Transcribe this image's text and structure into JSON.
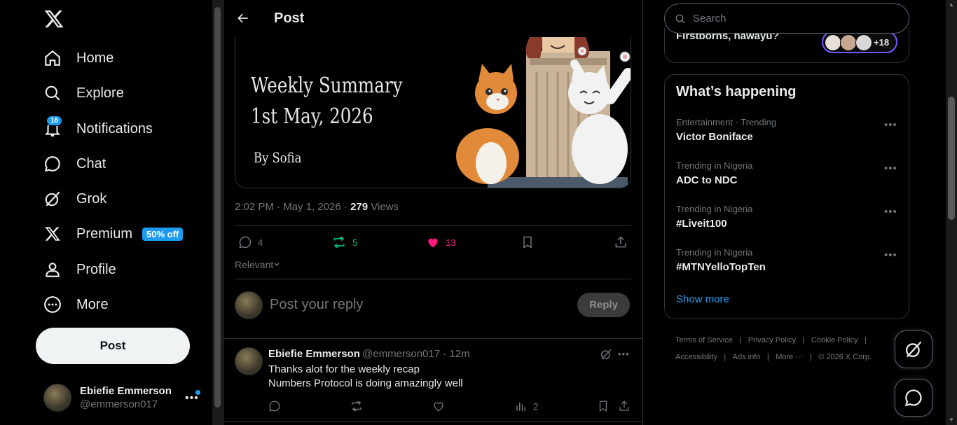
{
  "nav": {
    "items": [
      {
        "label": "Home",
        "icon": "home-icon"
      },
      {
        "label": "Explore",
        "icon": "search-icon"
      },
      {
        "label": "Notifications",
        "icon": "bell-icon",
        "badge": "18"
      },
      {
        "label": "Chat",
        "icon": "chat-icon"
      },
      {
        "label": "Grok",
        "icon": "grok-icon"
      },
      {
        "label": "Premium",
        "icon": "x-logo-icon",
        "promo": "50% off"
      },
      {
        "label": "Profile",
        "icon": "person-icon"
      },
      {
        "label": "More",
        "icon": "more-circle-icon"
      }
    ],
    "post_button": "Post"
  },
  "account": {
    "name": "Ebiefie Emmerson",
    "handle": "@emmerson017"
  },
  "header": {
    "title": "Post"
  },
  "media": {
    "line1": "Weekly Summary",
    "line2": "1st May, 2026",
    "line3": "By Sofia"
  },
  "post_meta": {
    "time": "2:02 PM · May 1, 2026 · ",
    "views_count": "279",
    "views_label": " Views"
  },
  "actions": {
    "replies": "4",
    "reposts": "5",
    "likes": "13"
  },
  "sort": {
    "label": "Relevant"
  },
  "reply_box": {
    "placeholder": "Post your reply",
    "button": "Reply"
  },
  "comment": {
    "name": "Ebiefie Emmerson",
    "handle": "@emmerson017 · 12m",
    "lines": [
      "Thanks alot for the weekly recap",
      "Numbers Protocol is doing amazingly well"
    ],
    "views": "2"
  },
  "search": {
    "placeholder": "Search"
  },
  "prev_card": {
    "text": "Firstborns, nawayu?",
    "count": "+18"
  },
  "trends": {
    "title": "What’s happening",
    "items": [
      {
        "context": "Entertainment · Trending",
        "name": "Victor Boniface"
      },
      {
        "context": "Trending in Nigeria",
        "name": "ADC to NDC"
      },
      {
        "context": "Trending in Nigeria",
        "name": "#Liveit100"
      },
      {
        "context": "Trending in Nigeria",
        "name": "#MTNYelloTopTen"
      }
    ],
    "show_more": "Show more"
  },
  "footer": {
    "links": [
      "Terms of Service",
      "Privacy Policy",
      "Cookie Policy",
      "Accessibility",
      "Ads info",
      "More ···"
    ],
    "copyright": "© 2026 X Corp."
  },
  "colors": {
    "accent": "#1d9bf0",
    "repost": "#00ba7c",
    "like": "#f91880",
    "background": "#000000"
  }
}
